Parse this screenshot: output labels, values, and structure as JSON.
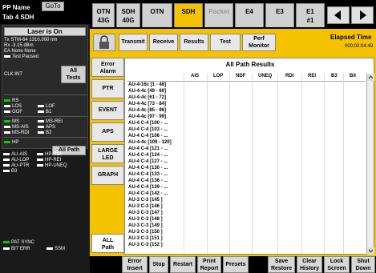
{
  "header": {
    "pp_name": "PP Name",
    "goto_label": "GoTo",
    "tab_label": "Tab 4 SDH"
  },
  "laser": {
    "button_label": "Laser is On",
    "lines": [
      "Tx STM-64 1310.000 nm",
      "Rx -3.15 dBm",
      "EA None None",
      "Test Paused"
    ],
    "clock": "CLK:INT",
    "all_tests_line1": "All",
    "all_tests_line2": "Tests"
  },
  "alarms": {
    "group1": [
      {
        "label": "RS",
        "led": "green"
      },
      {
        "label": "LOS",
        "led": "white"
      },
      {
        "label": "LOF",
        "led": "white"
      },
      {
        "label": "OOF",
        "led": "white"
      },
      {
        "label": "B1",
        "led": "white"
      }
    ],
    "group2": [
      {
        "label": "MS",
        "led": "green"
      },
      {
        "label": "MS-REI",
        "led": "white"
      },
      {
        "label": "MS-AIS",
        "led": "white"
      },
      {
        "label": "APS",
        "led": "white"
      },
      {
        "label": "MS-RDI",
        "led": "white"
      },
      {
        "label": "B2",
        "led": "white"
      }
    ],
    "group3": [
      {
        "label": "HP",
        "led": "green"
      },
      {
        "label": "AU-AIS",
        "led": "white"
      },
      {
        "label": "HP-RDI",
        "led": "white"
      },
      {
        "label": "AU-LOP",
        "led": "white"
      },
      {
        "label": "HP-REI",
        "led": "white"
      },
      {
        "label": "AU-PTR",
        "led": "white"
      },
      {
        "label": "HP-UNEQ",
        "led": "white"
      },
      {
        "label": "B3",
        "led": "white"
      }
    ],
    "all_path_label": "All Path"
  },
  "sync": {
    "pat_sync": "PAT SYNC",
    "bit_err": "BIT ERR",
    "ssm": "SSM"
  },
  "tabs": [
    {
      "line1": "OTN",
      "line2": "43G",
      "state": "normal"
    },
    {
      "line1": "SDH",
      "line2": "40G",
      "state": "normal"
    },
    {
      "line1": "OTN",
      "line2": "",
      "state": "normal"
    },
    {
      "line1": "SDH",
      "line2": "",
      "state": "active"
    },
    {
      "line1": "Packet",
      "line2": "",
      "state": "disabled"
    },
    {
      "line1": "E4",
      "line2": "",
      "state": "normal"
    },
    {
      "line1": "E3",
      "line2": "",
      "state": "normal"
    },
    {
      "line1": "E1",
      "line2": "#1",
      "state": "normal"
    }
  ],
  "toolbar": {
    "transmit": "Transmit",
    "receive": "Receive",
    "results": "Results",
    "test": "Test",
    "perf_line1": "Perf",
    "perf_line2": "Monitor"
  },
  "elapsed": {
    "title": "Elapsed Time",
    "value": "000:00:04:49"
  },
  "side_nav": [
    {
      "line1": "Error",
      "line2": "Alarm"
    },
    {
      "line1": "PTR",
      "line2": ""
    },
    {
      "line1": "EVENT",
      "line2": ""
    },
    {
      "line1": "APS",
      "line2": ""
    },
    {
      "line1": "LARGE",
      "line2": "LED"
    },
    {
      "line1": "GRAPH",
      "line2": ""
    },
    {
      "line1": "ALL",
      "line2": "Path"
    }
  ],
  "results": {
    "title": "All Path Results",
    "columns": [
      "AIS",
      "LOP",
      "NDF",
      "UNEQ",
      "RDI",
      "REI",
      "B3",
      "Bit"
    ],
    "rows": [
      "AU-4-16c [1 - 48]",
      "AU-4-4c [49 - 60]",
      "AU-4-4c [61 - 72]",
      "AU-4-4c [73 - 84]",
      "AU-4-4c [85 - 96]",
      "AU-4-4c [97 - 99]",
      "AU-4 C-4 [100 - ...",
      "AU-4 C-4 [103 - ...",
      "AU-4 C-4 [106 - ...",
      "AU-4-4c [109 - 120]",
      "AU-4 C-4 [121 - ...",
      "AU-4 C-4 [124 - ...",
      "AU-4 C-4 [127 - ...",
      "AU-4 C-4 [130 - ...",
      "AU-4 C-4 [133 - ...",
      "AU-4 C-4 [136 - ...",
      "AU-4 C-4 [139 - ...",
      "AU-4 C-4 [142 - ...",
      "AU-3 C-3 [145 ]",
      "AU-3 C-3 [146 ]",
      "AU-3 C-3 [147 ]",
      "AU-3 C-3 [148 ]",
      "AU-3 C-3 [149 ]",
      "AU-3 C-3 [150 ]",
      "AU-3 C-3 [151 ]",
      "AU-3 C-3 [152 ]"
    ]
  },
  "bottom_bar": [
    {
      "line1": "Error",
      "line2": "Insert"
    },
    {
      "line1": "Stop",
      "line2": ""
    },
    {
      "line1": "Restart",
      "line2": ""
    },
    {
      "line1": "Print",
      "line2": "Report"
    },
    {
      "line1": "Presets",
      "line2": ""
    },
    {
      "line1": "Save",
      "line2": "Restore"
    },
    {
      "line1": "Clear",
      "line2": "History"
    },
    {
      "line1": "Lock",
      "line2": "Screen"
    },
    {
      "line1": "Shut",
      "line2": "Down"
    }
  ],
  "colors": {
    "accent": "#f5c200",
    "led_green": "#00d000"
  }
}
